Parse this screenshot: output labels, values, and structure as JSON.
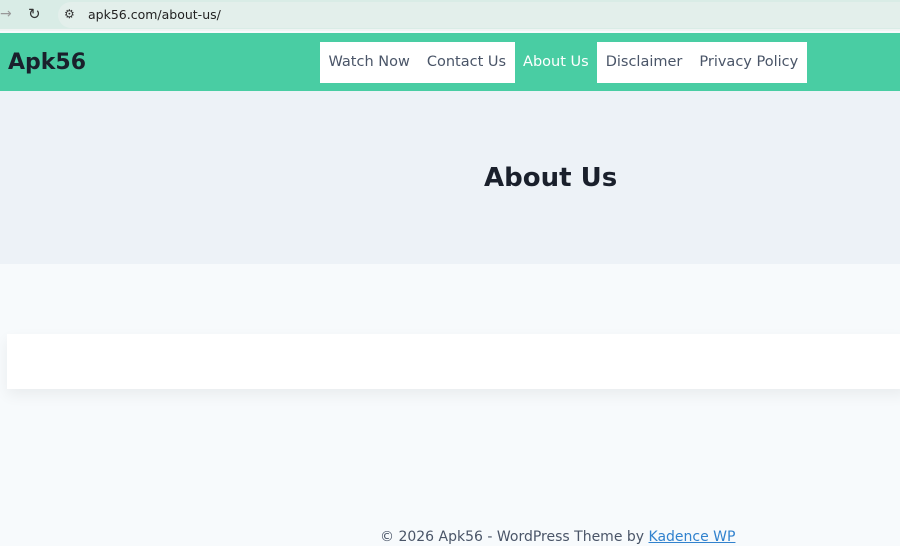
{
  "browser": {
    "url": "apk56.com/about-us/"
  },
  "site": {
    "logo": "Apk56"
  },
  "nav": {
    "items": [
      {
        "label": "Watch Now"
      },
      {
        "label": "Contact Us"
      },
      {
        "label": "About Us",
        "active": true
      },
      {
        "label": "Disclaimer"
      },
      {
        "label": "Privacy Policy"
      }
    ]
  },
  "page": {
    "title": "About Us"
  },
  "footer": {
    "text": "© 2026 Apk56 - WordPress Theme by ",
    "link": "Kadence WP"
  }
}
